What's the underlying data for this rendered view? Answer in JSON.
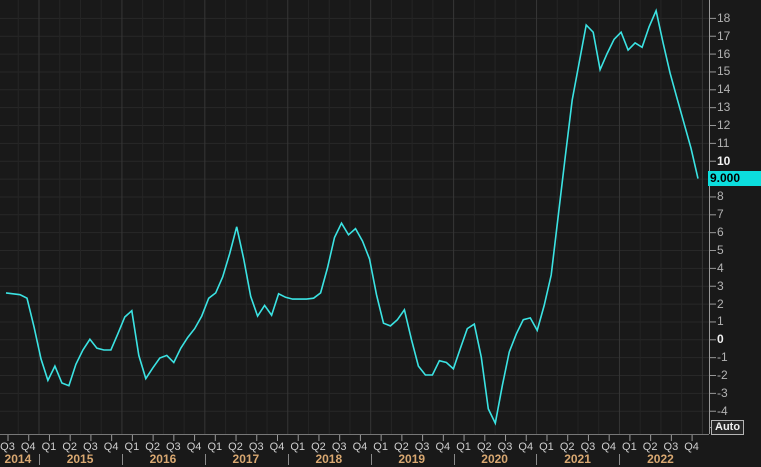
{
  "colors": {
    "background": "#191919",
    "line": "#3be3e3",
    "badge_bg": "#0cdede",
    "grid_minor": "#252525",
    "grid_year": "#363636",
    "grid_horizontal": "#282828",
    "axis": "#999999",
    "year_label": "#d9a871"
  },
  "y_axis": {
    "ticks": [
      "18",
      "17",
      "16",
      "15",
      "14",
      "13",
      "12",
      "11",
      "10",
      "8",
      "7",
      "6",
      "5",
      "4",
      "3",
      "2",
      "1",
      "0",
      "-1",
      "-2",
      "-3",
      "-4"
    ],
    "bold_ticks": [
      "10",
      "0"
    ],
    "last_value_label": "9.000",
    "auto_label": "Auto"
  },
  "x_axis": {
    "quarters": [
      "Q3",
      "Q4",
      "Q1",
      "Q2",
      "Q3",
      "Q4",
      "Q1",
      "Q2",
      "Q3",
      "Q4",
      "Q1",
      "Q2",
      "Q3",
      "Q4",
      "Q1",
      "Q2",
      "Q3",
      "Q4",
      "Q1",
      "Q2",
      "Q3",
      "Q4",
      "Q1",
      "Q2",
      "Q3",
      "Q4",
      "Q1",
      "Q2",
      "Q3",
      "Q4",
      "Q1",
      "Q2",
      "Q3",
      "Q4"
    ],
    "years": [
      "2014",
      "2015",
      "2016",
      "2017",
      "2018",
      "2019",
      "2020",
      "2021",
      "2022"
    ]
  },
  "chart_data": {
    "type": "line",
    "title": "",
    "xlabel": "",
    "ylabel": "",
    "frequency": "monthly",
    "x_start": "2014-07",
    "x_end": "2022-10",
    "ylim": [
      -5.2,
      19
    ],
    "y_gridline_step": 1,
    "grid": true,
    "legend_position": "none",
    "line_color": "#3be3e3",
    "last_value": 9.0,
    "max_value": 18.4,
    "min_value": -4.7,
    "values": [
      2.6,
      2.55,
      2.5,
      2.3,
      0.7,
      -1.1,
      -2.3,
      -1.5,
      -2.45,
      -2.6,
      -1.4,
      -0.6,
      0.0,
      -0.5,
      -0.6,
      -0.6,
      0.3,
      1.25,
      1.6,
      -0.9,
      -2.2,
      -1.6,
      -1.05,
      -0.9,
      -1.3,
      -0.5,
      0.1,
      0.6,
      1.3,
      2.3,
      2.6,
      3.5,
      4.8,
      6.3,
      4.5,
      2.4,
      1.3,
      1.9,
      1.35,
      2.55,
      2.35,
      2.25,
      2.25,
      2.25,
      2.3,
      2.6,
      4.0,
      5.7,
      6.5,
      5.85,
      6.2,
      5.5,
      4.5,
      2.5,
      0.9,
      0.75,
      1.1,
      1.65,
      0.0,
      -1.5,
      -2.0,
      -2.0,
      -1.2,
      -1.3,
      -1.65,
      -0.5,
      0.6,
      0.85,
      -1.0,
      -3.9,
      -4.7,
      -2.6,
      -0.7,
      0.3,
      1.1,
      1.2,
      0.5,
      1.9,
      3.6,
      6.9,
      10.2,
      13.4,
      15.5,
      17.6,
      17.2,
      15.1,
      16.0,
      16.8,
      17.2,
      16.2,
      16.6,
      16.35,
      17.5,
      18.4,
      16.6,
      14.9,
      13.5,
      12.1,
      10.7,
      9.0
    ]
  }
}
